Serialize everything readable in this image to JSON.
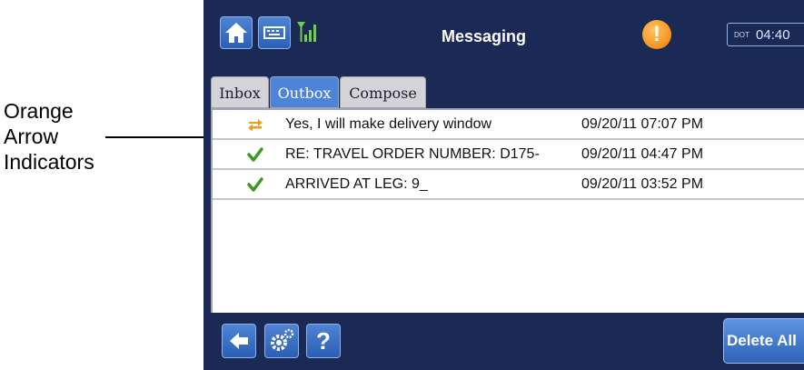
{
  "annotation": {
    "lines": [
      "Orange",
      "Arrow",
      "Indicators"
    ]
  },
  "header": {
    "title": "Messaging",
    "clock_status": "DOT",
    "clock_time": "04:40"
  },
  "tabs": [
    {
      "label": "Inbox",
      "active": false
    },
    {
      "label": "Outbox",
      "active": true
    },
    {
      "label": "Compose",
      "active": false
    }
  ],
  "messages": [
    {
      "icon": "orange-arrow-icon",
      "subject": "Yes, I will make delivery window",
      "date": "09/20/11 07:07 PM"
    },
    {
      "icon": "check-icon",
      "subject": "RE: TRAVEL ORDER NUMBER: D175-",
      "date": "09/20/11 04:47 PM"
    },
    {
      "icon": "check-icon",
      "subject": "ARRIVED AT LEG: 9_",
      "date": "09/20/11 03:52 PM"
    }
  ],
  "footer": {
    "help_label": "?",
    "delete_all_label": "Delete All"
  },
  "colors": {
    "background": "#1a2a55",
    "accent": "#4d84d7",
    "indicator_orange": "#f29a1e",
    "check_green": "#3a9b22"
  }
}
